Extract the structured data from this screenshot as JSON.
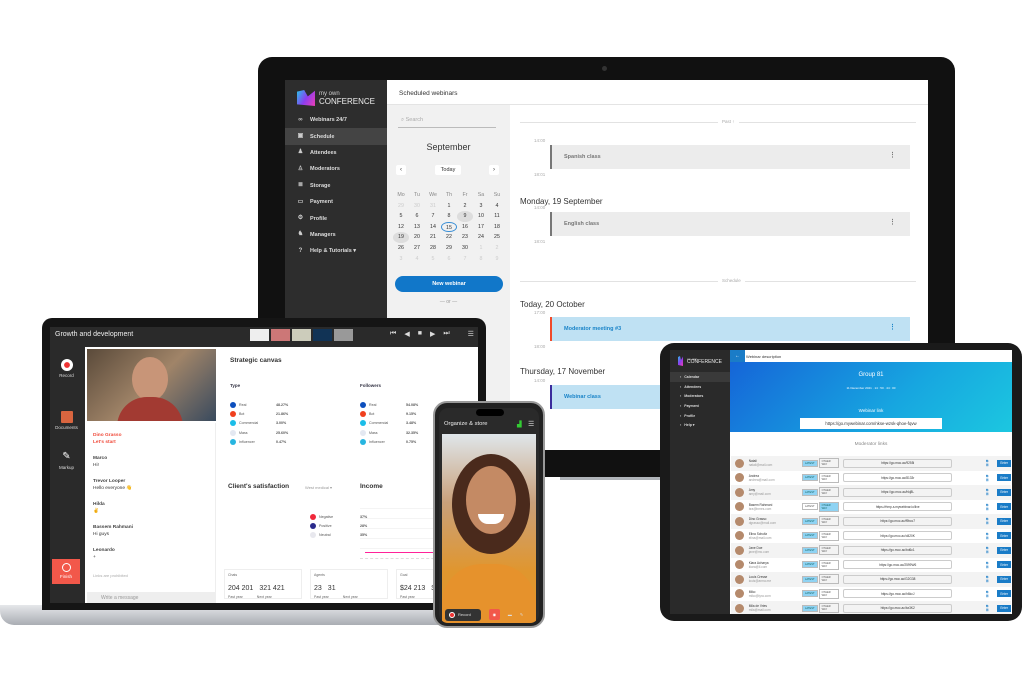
{
  "monitor": {
    "brand": {
      "line1": "my own",
      "line2": "CONFERENCE"
    },
    "sidebar": [
      {
        "label": "Webinars 24/7",
        "icon": "infinity-icon"
      },
      {
        "label": "Schedule",
        "icon": "calendar-icon",
        "active": true
      },
      {
        "label": "Attendees",
        "icon": "attendees-icon"
      },
      {
        "label": "Moderators",
        "icon": "moderator-icon"
      },
      {
        "label": "Storage",
        "icon": "storage-icon"
      },
      {
        "label": "Payment",
        "icon": "payment-icon"
      },
      {
        "label": "Profile",
        "icon": "gear-icon"
      },
      {
        "label": "Managers",
        "icon": "managers-icon"
      },
      {
        "label": "Help & Tutorials ▾",
        "icon": "help-icon"
      }
    ],
    "header": "Scheduled webinars",
    "search_placeholder": "Search",
    "month": "September",
    "today_label": "Today",
    "weekdays": [
      "Mo",
      "Tu",
      "We",
      "Th",
      "Fr",
      "Sa",
      "Su"
    ],
    "days": [
      "29",
      "30",
      "31",
      "1",
      "2",
      "3",
      "4",
      "5",
      "6",
      "7",
      "8",
      "9",
      "10",
      "11",
      "12",
      "13",
      "14",
      "15",
      "16",
      "17",
      "18",
      "19",
      "20",
      "21",
      "22",
      "23",
      "24",
      "25",
      "26",
      "27",
      "28",
      "29",
      "30",
      "1",
      "2",
      "3",
      "4",
      "5",
      "6",
      "7",
      "8",
      "9"
    ],
    "new_webinar": "New webinar",
    "or": "— or —",
    "past_label": "Past ↑",
    "schedule_label": "Schedule",
    "events": [
      {
        "day": "",
        "start": "14:00",
        "end": "18:01",
        "title": "Spanish class",
        "style": "past"
      },
      {
        "day": "Monday, 19 September",
        "start": "14:00",
        "end": "18:01",
        "title": "English class",
        "style": "past"
      },
      {
        "day": "Today, 20 October",
        "start": "17:00",
        "end": "18:00",
        "title": "Moderator meeting #3",
        "style": "active",
        "accent": "#f04a2a"
      },
      {
        "day": "Thursday, 17 November",
        "start": "14:00",
        "end": "",
        "title": "Webinar class",
        "style": "active",
        "accent": "#3b2c9c"
      }
    ]
  },
  "laptop": {
    "title": "Growth and development",
    "tools": {
      "record": "Record",
      "documents": "Documents",
      "markup": "Markup",
      "finish": "Finish"
    },
    "chat": [
      {
        "name": "Dino Grasso",
        "text": "Let's start",
        "highlight": true
      },
      {
        "name": "Marco",
        "text": "Hi!"
      },
      {
        "name": "Trevor Looper",
        "text": "Hello everyone 👋"
      },
      {
        "name": "Hilda",
        "text": "✌"
      },
      {
        "name": "Bassem Rahmani",
        "text": "Hi guys"
      },
      {
        "name": "Leonardo",
        "text": "+"
      }
    ],
    "links_note": "Links are prohibited",
    "chat_placeholder": "Write a message",
    "dashboard": {
      "title": "Strategic canvas",
      "type": {
        "title": "Type",
        "items": [
          {
            "label": "Real",
            "value": "48.27%",
            "pct": 48.27,
            "color": "#0d4fbd"
          },
          {
            "label": "Bot",
            "value": "21.86%",
            "pct": 21.86,
            "color": "#f0401e"
          },
          {
            "label": "Commercial",
            "value": "3.00%",
            "pct": 3.0,
            "color": "#1bbde8"
          },
          {
            "label": "Mass",
            "value": "25.60%",
            "pct": 25.6,
            "color": "#e4e8f1"
          },
          {
            "label": "Influencer",
            "value": "0.47%",
            "pct": 0.47,
            "color": "#27b5e0"
          }
        ]
      },
      "followers": {
        "title": "Followers",
        "items": [
          {
            "label": "Real",
            "value": "54.08%",
            "pct": 54.08,
            "color": "#0d4fbd"
          },
          {
            "label": "Bot",
            "value": "9.15%",
            "pct": 9.15,
            "color": "#f0401e"
          },
          {
            "label": "Commercial",
            "value": "3.48%",
            "pct": 3.48,
            "color": "#1bbde8"
          },
          {
            "label": "Mass",
            "value": "32.35%",
            "pct": 32.35,
            "color": "#e4e8f1"
          },
          {
            "label": "Influencer",
            "value": "0.75%",
            "pct": 0.75,
            "color": "#27b5e0"
          }
        ]
      },
      "satisfaction": {
        "title": "Client's satisfaction",
        "filter": "West medical ▾",
        "items": [
          {
            "label": "Negative",
            "value": "37%",
            "pct": 37,
            "color": "#f0283a"
          },
          {
            "label": "Positive",
            "value": "28%",
            "pct": 28,
            "color": "#2a2a8c"
          },
          {
            "label": "Neutral",
            "value": "35%",
            "pct": 35,
            "color": "#e8e8ee"
          }
        ]
      },
      "income_title": "Income",
      "kpis": [
        {
          "label": "Chats",
          "v1": "204 201",
          "v2": "321 421",
          "s1": "Past year",
          "s2": "Next year"
        },
        {
          "label": "Agents",
          "v1": "23",
          "v2": "31",
          "s1": "Past year",
          "s2": "Next year"
        },
        {
          "label": "Goal",
          "v1": "$24 213",
          "v2": "$",
          "s1": "Past year",
          "s2": ""
        }
      ]
    }
  },
  "phone": {
    "title": "Organize & store",
    "record": "Record"
  },
  "tablet": {
    "brand": {
      "line1": "my own",
      "line2": "CONFERENCE"
    },
    "sidebar": [
      "Calendar",
      "Attendees",
      "Moderators",
      "Payment",
      "Profile",
      "Help ▾"
    ],
    "header": "Webinar description",
    "group": "Group 81",
    "meta": "11 December 2021 · 14 : 50 · 44 : 00",
    "link_label": "Webinar link",
    "link": "https://go.mywebinar.com/nkse-wzsk-qhoe-fqvw",
    "mod_title": "Moderator links",
    "tag1": "LATEST",
    "tag2": "OTHER WAY",
    "copy": "⧉ ▣",
    "enter": "Enter",
    "moderators": [
      {
        "name": "Natali",
        "email": "natali@mail.com",
        "url": "https://go.moc.ac/9255i"
      },
      {
        "name": "Andrea",
        "email": "andrea@mail.com",
        "url": "https://go.moc.ac/8133r"
      },
      {
        "name": "Amy",
        "email": "amy@mail.com",
        "url": "https://go.moc.ac/hkj8L"
      },
      {
        "name": "Basem Rahmani",
        "email": "bra@bmes.com",
        "url": "https://rtmp-s.mywebinar.io/live"
      },
      {
        "name": "Dino Grasso",
        "email": "dgrasso@mail.com",
        "url": "https://go.moc.ac/f9bcc7"
      },
      {
        "name": "Elina Schultz",
        "email": "elina@mail.com",
        "url": "https://go.moc.ac/d420K"
      },
      {
        "name": "Jane Doe",
        "email": "jane@mc.com",
        "url": "https://go.moc.ac/bd6c1"
      },
      {
        "name": "Kiara Acharya",
        "email": "kiara@il.com",
        "url": "https://go.moc.ac/2599W6"
      },
      {
        "name": "Louis Cresse",
        "email": "louis@arma.me",
        "url": "https://go.moc.ac/G2G38"
      },
      {
        "name": "Miko",
        "email": "miko@lyra.com",
        "url": "https://go.moc.ac/h6kcJ"
      },
      {
        "name": "Mila de Vries",
        "email": "mila@mail.com",
        "url": "https://go.moc.ac/bz3K2"
      }
    ]
  }
}
